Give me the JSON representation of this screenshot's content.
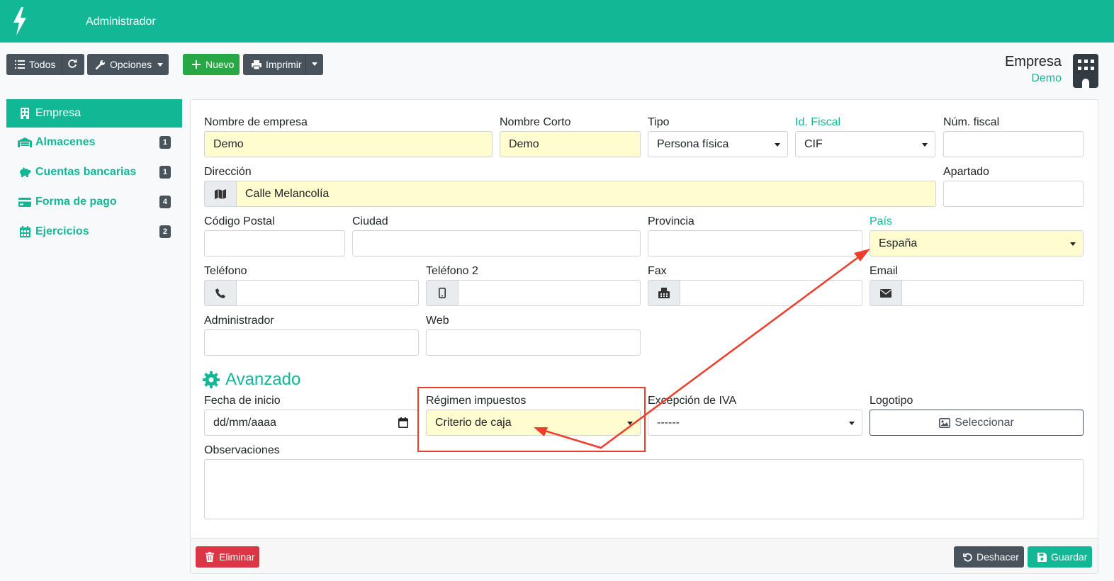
{
  "app": {
    "title": "Administrador",
    "brand_icon": "bolt-icon",
    "accent_color": "#12b896"
  },
  "toolbar": {
    "todos_label": "Todos",
    "opciones_label": "Opciones",
    "nuevo_label": "Nuevo",
    "imprimir_label": "Imprimir"
  },
  "header": {
    "title": "Empresa",
    "subtitle": "Demo"
  },
  "sidebar": {
    "items": [
      {
        "label": "Empresa",
        "icon": "building-icon",
        "active": true
      },
      {
        "label": "Almacenes",
        "icon": "warehouse-icon",
        "badge": "1"
      },
      {
        "label": "Cuentas bancarias",
        "icon": "piggy-bank-icon",
        "badge": "1"
      },
      {
        "label": "Forma de pago",
        "icon": "credit-card-icon",
        "badge": "4"
      },
      {
        "label": "Ejercicios",
        "icon": "calendar-icon",
        "badge": "2"
      }
    ]
  },
  "form": {
    "nombre": {
      "label": "Nombre de empresa",
      "value": "Demo"
    },
    "nombre_corto": {
      "label": "Nombre Corto",
      "value": "Demo"
    },
    "tipo": {
      "label": "Tipo",
      "value": "Persona física"
    },
    "id_fiscal": {
      "label": "Id. Fiscal",
      "value": "CIF"
    },
    "num_fiscal": {
      "label": "Núm. fiscal",
      "value": ""
    },
    "direccion": {
      "label": "Dirección",
      "value": "Calle Melancolía"
    },
    "apartado": {
      "label": "Apartado",
      "value": ""
    },
    "codigo_postal": {
      "label": "Código Postal",
      "value": ""
    },
    "ciudad": {
      "label": "Ciudad",
      "value": ""
    },
    "provincia": {
      "label": "Provincia",
      "value": ""
    },
    "pais": {
      "label": "País",
      "value": "España"
    },
    "telefono": {
      "label": "Teléfono",
      "value": ""
    },
    "telefono2": {
      "label": "Teléfono 2",
      "value": ""
    },
    "fax": {
      "label": "Fax",
      "value": ""
    },
    "email": {
      "label": "Email",
      "value": ""
    },
    "administrador": {
      "label": "Administrador",
      "value": ""
    },
    "web": {
      "label": "Web",
      "value": ""
    }
  },
  "advanced": {
    "title": "Avanzado",
    "fecha_inicio": {
      "label": "Fecha de inicio",
      "value": "dd/mm/aaaa"
    },
    "regimen": {
      "label": "Régimen impuestos",
      "value": "Criterio de caja"
    },
    "excepcion_iva": {
      "label": "Excepción de IVA",
      "value": "------"
    },
    "logotipo": {
      "label": "Logotipo",
      "button": "Seleccionar"
    },
    "observaciones": {
      "label": "Observaciones",
      "value": ""
    }
  },
  "footer": {
    "eliminar": "Eliminar",
    "deshacer": "Deshacer",
    "guardar": "Guardar"
  },
  "annotation": {
    "color": "#f03c2a"
  }
}
